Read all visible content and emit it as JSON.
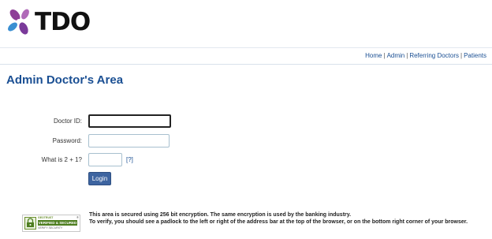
{
  "brand": {
    "logo_text": "TDO",
    "colors": {
      "petal_purple": "#8e3f97",
      "petal_blue": "#3a8fd2",
      "petal_violet": "#b06ab8"
    }
  },
  "nav": {
    "items": [
      {
        "label": "Home"
      },
      {
        "label": "Admin"
      },
      {
        "label": "Referring Doctors"
      },
      {
        "label": "Patients"
      }
    ],
    "separator": "|"
  },
  "page_title": "Admin Doctor's Area",
  "form": {
    "doctor_id": {
      "label": "Doctor ID:",
      "value": ""
    },
    "password": {
      "label": "Password:",
      "value": ""
    },
    "captcha": {
      "label": "What is 2 + 1?",
      "value": "",
      "help_link": "[?]"
    },
    "login_label": "Login"
  },
  "security": {
    "badge": {
      "brand": "GEOTRUST",
      "verified": "VERIFIED & SECURED",
      "subtitle": "VERIFY SECURITY",
      "registered": "®",
      "icon": "lock-icon"
    },
    "line1": "This area is secured using 256 bit encryption. The same encryption is used by the banking industry.",
    "line2": "To verify, you should see a padlock to the left or right of the address bar at the top of the browser, or on the bottom right corner of your browser."
  },
  "colors": {
    "link": "#1a4f93",
    "title": "#1a4f93",
    "button_bg": "#3d64a0",
    "badge_green": "#4d7d1f"
  }
}
